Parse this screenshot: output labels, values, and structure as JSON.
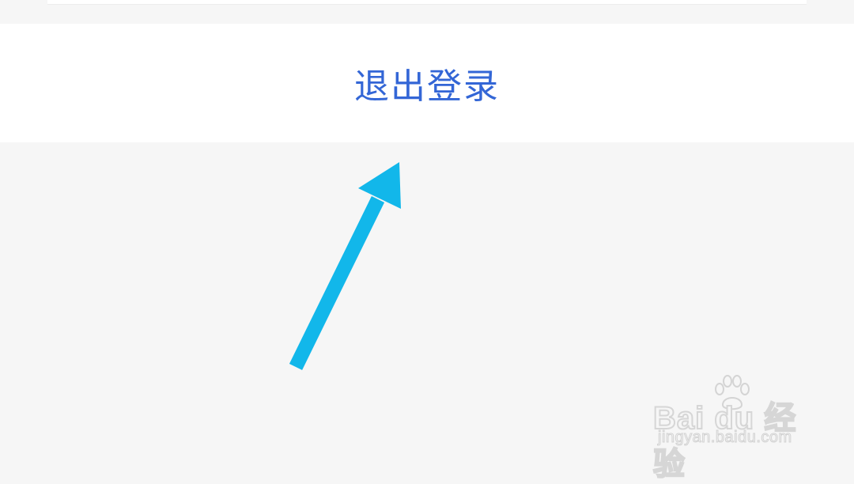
{
  "logout": {
    "label": "退出登录",
    "label_color": "#3366d6"
  },
  "annotation": {
    "icon": "arrow-icon",
    "color": "#12b7ea"
  },
  "watermark": {
    "logo_text": "Bai du 经验",
    "url_text": "jingyan.baidu.com",
    "icon": "paw-icon"
  }
}
